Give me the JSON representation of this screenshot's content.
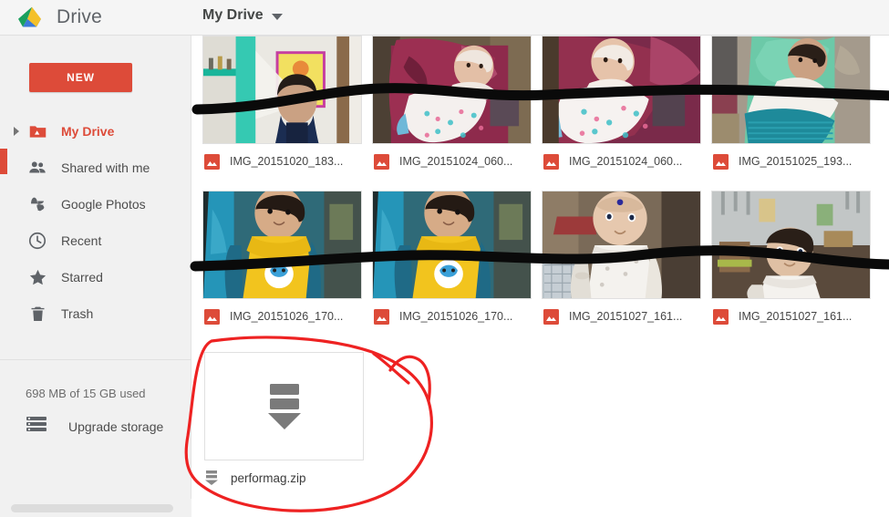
{
  "app": {
    "brand": "Drive",
    "logo_icon": "google-drive-logo-icon"
  },
  "header": {
    "breadcrumb_label": "My Drive",
    "breadcrumb_caret_icon": "chevron-down-icon"
  },
  "sidebar": {
    "new_button_label": "NEW",
    "items": [
      {
        "label": "My Drive",
        "icon": "drive-folder-icon",
        "active": true,
        "expandable": true
      },
      {
        "label": "Shared with me",
        "icon": "people-icon",
        "active": false,
        "expandable": false
      },
      {
        "label": "Google Photos",
        "icon": "google-photos-icon",
        "active": false,
        "expandable": false
      },
      {
        "label": "Recent",
        "icon": "clock-icon",
        "active": false,
        "expandable": false
      },
      {
        "label": "Starred",
        "icon": "star-icon",
        "active": false,
        "expandable": false
      },
      {
        "label": "Trash",
        "icon": "trash-icon",
        "active": false,
        "expandable": false
      }
    ],
    "storage_text": "698 MB of 15 GB used",
    "upgrade_label": "Upgrade storage",
    "upgrade_icon": "storage-bars-icon",
    "scrollbar": "horizontal-scrollbar"
  },
  "files": {
    "row1": [
      {
        "name": "IMG_20151020_183...",
        "icon": "image-file-icon"
      },
      {
        "name": "IMG_20151024_060...",
        "icon": "image-file-icon"
      },
      {
        "name": "IMG_20151024_060...",
        "icon": "image-file-icon"
      },
      {
        "name": "IMG_20151025_193...",
        "icon": "image-file-icon"
      }
    ],
    "row2": [
      {
        "name": "IMG_20151026_170...",
        "icon": "image-file-icon"
      },
      {
        "name": "IMG_20151026_170...",
        "icon": "image-file-icon"
      },
      {
        "name": "IMG_20151027_161...",
        "icon": "image-file-icon"
      },
      {
        "name": "IMG_20151027_161...",
        "icon": "image-file-icon"
      }
    ],
    "archive": {
      "name": "performag.zip",
      "icon": "archive-file-icon",
      "thumb_icon": "archive-download-icon"
    }
  },
  "annotations": {
    "highlight_color": "#ee2222",
    "strike_color": "#0a0a0a",
    "circle_target": "performag.zip",
    "strike_count": 2,
    "circle_count": 1
  },
  "colors": {
    "accent_red": "#dd4b39",
    "sidebar_bg": "#f1f1f1",
    "topbar_bg": "#f5f5f5",
    "text": "#4d4d4d"
  }
}
